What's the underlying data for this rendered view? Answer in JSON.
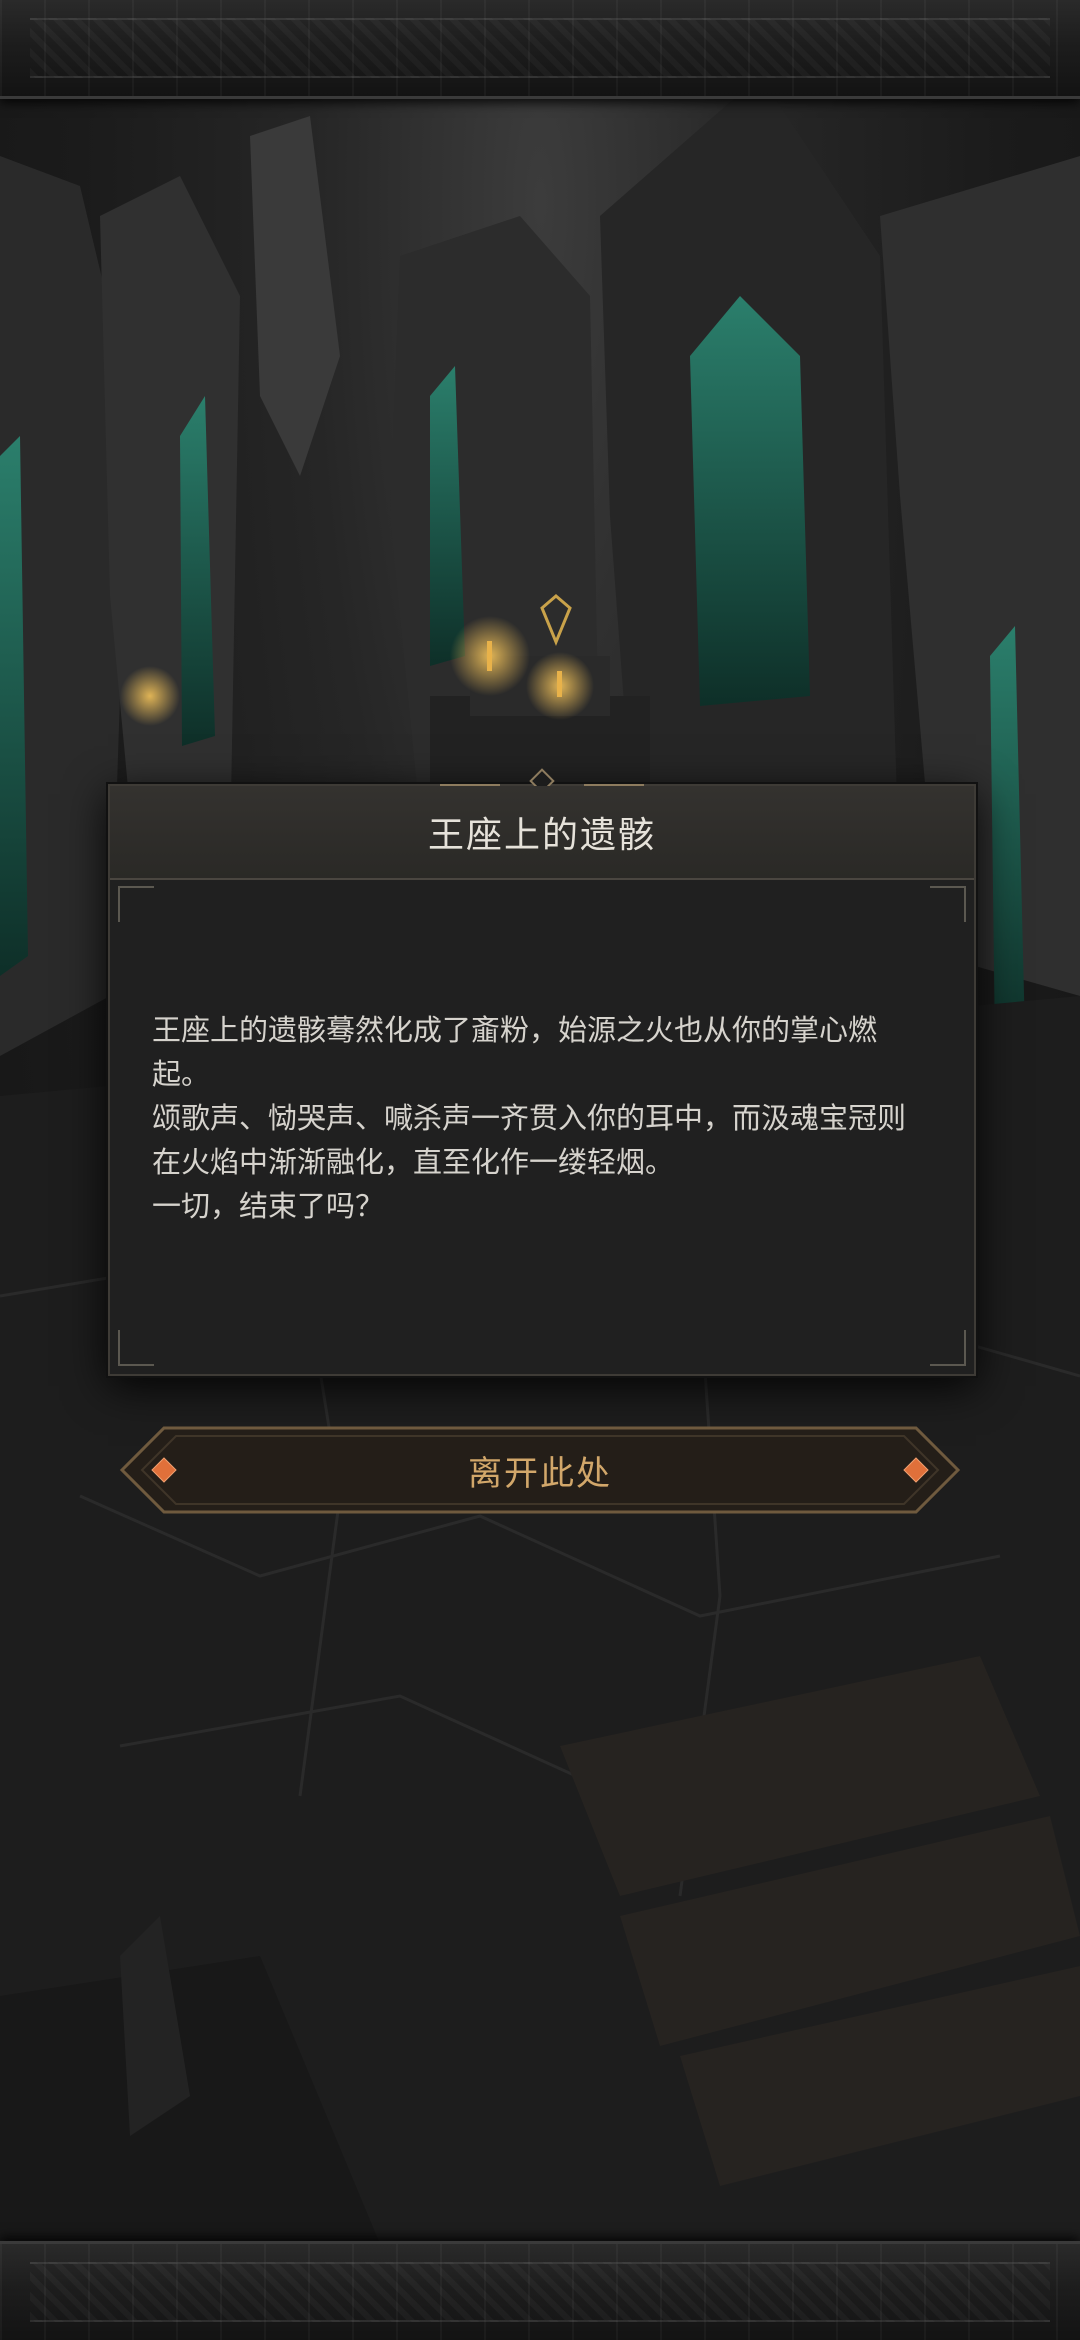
{
  "dialog": {
    "title": "王座上的遗骸",
    "paragraphs": [
      "王座上的遗骸蓦然化成了齑粉，始源之火也从你的掌心燃起。",
      "颂歌声、恸哭声、喊杀声一齐贯入你的耳中，而汲魂宝冠则在火焰中渐渐融化，直至化作一缕轻烟。",
      "一切，结束了吗？"
    ]
  },
  "actions": {
    "leave_label": "离开此处"
  },
  "colors": {
    "button_text": "#d2a76a",
    "button_gem": "#e0703a",
    "crystal_teal": "#1f6a5a",
    "candle_glow": "#e8b24a"
  },
  "icons": {
    "left_gem": "diamond-gem-icon",
    "right_gem": "diamond-gem-icon",
    "marker": "chevron-marker-icon"
  }
}
